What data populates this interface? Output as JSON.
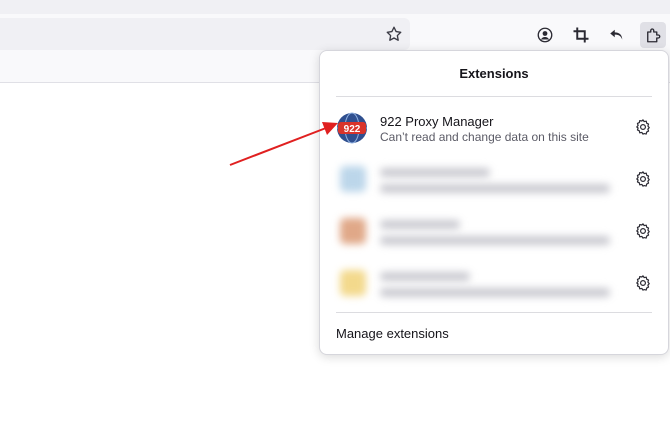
{
  "panel": {
    "title": "Extensions",
    "manage_label": "Manage extensions",
    "extensions": [
      {
        "name": "922 Proxy Manager",
        "description": "Can’t read and change data on this site",
        "icon": "922",
        "icon_color": "#d9342b",
        "redacted": false
      },
      {
        "name": "",
        "description": "",
        "redacted": true,
        "icon_color": "#bcd6ea"
      },
      {
        "name": "",
        "description": "",
        "redacted": true,
        "icon_color": "#e0a888"
      },
      {
        "name": "",
        "description": "",
        "redacted": true,
        "icon_color": "#f3d98c"
      }
    ]
  },
  "toolbar": {
    "icons": [
      "star-icon",
      "account-icon",
      "crop-icon",
      "undo-icon",
      "extensions-icon"
    ]
  },
  "annotation": {
    "arrow_color": "#e02020"
  }
}
